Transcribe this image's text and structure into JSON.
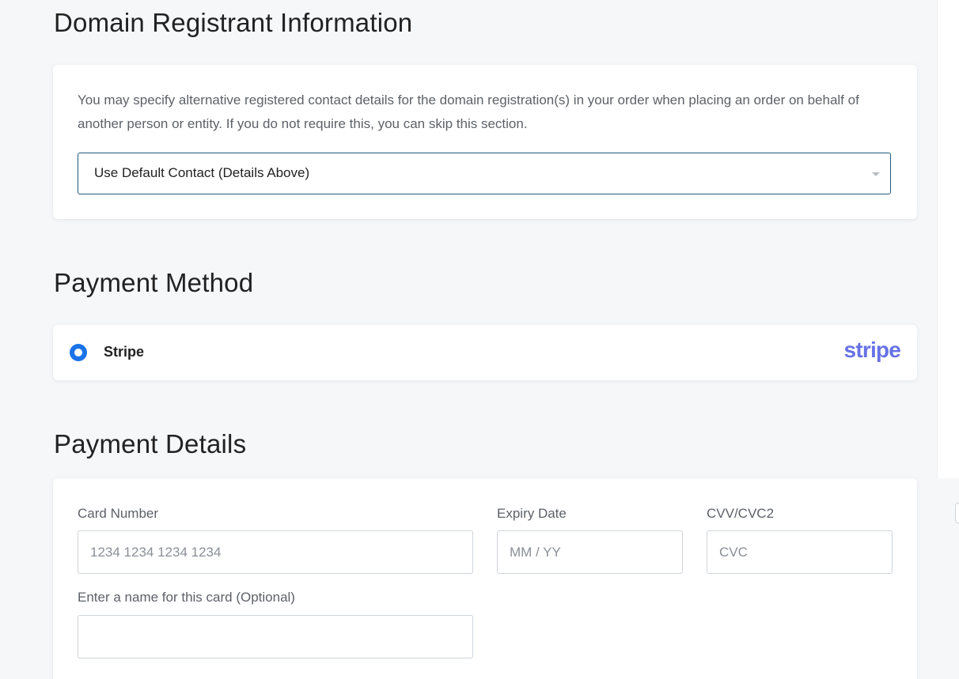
{
  "registrant": {
    "title": "Domain Registrant Information",
    "description": "You may specify alternative registered contact details for the domain registration(s) in your order when placing an order on behalf of another person or entity. If you do not require this, you can skip this section.",
    "contact_select_value": "Use Default Contact (Details Above)"
  },
  "payment_method": {
    "title": "Payment Method",
    "options": [
      {
        "label": "Stripe",
        "logo_text": "stripe",
        "selected": true
      }
    ]
  },
  "payment_details": {
    "title": "Payment Details",
    "card_number": {
      "label": "Card Number",
      "placeholder": "1234 1234 1234 1234",
      "value": ""
    },
    "expiry": {
      "label": "Expiry Date",
      "placeholder": "MM / YY",
      "value": ""
    },
    "cvc": {
      "label": "CVV/CVC2",
      "placeholder": "CVC",
      "value": ""
    },
    "card_name": {
      "label": "Enter a name for this card (Optional)",
      "placeholder": "",
      "value": ""
    }
  },
  "colors": {
    "accent": "#1a73e8",
    "stripe_brand": "#6772e5",
    "select_border": "#1f5a7a"
  }
}
